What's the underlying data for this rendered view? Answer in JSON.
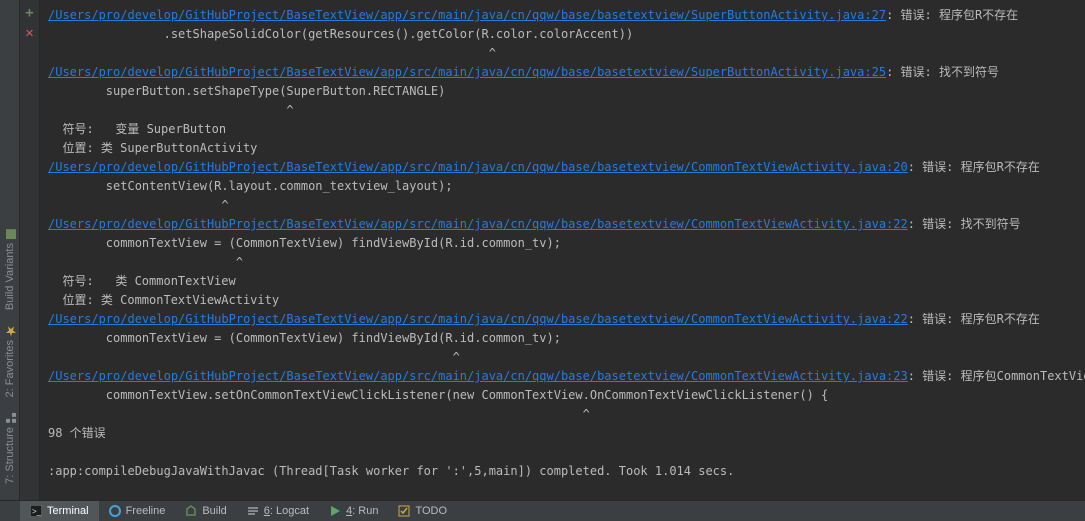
{
  "sidebar": {
    "tabs": [
      {
        "label": "Build Variants"
      },
      {
        "label": "2: Favorites"
      },
      {
        "label": "7: Structure"
      }
    ]
  },
  "gutter": {
    "plus": "+",
    "cross": "✕"
  },
  "console": {
    "entries": [
      {
        "link": "/Users/pro/develop/GitHubProject/BaseTextView/app/src/main/java/cn/qqw/base/basetextview/SuperButtonActivity.java:27",
        "label": ": 错误: 程序包R不存在",
        "code": "                .setShapeSolidColor(getResources().getColor(R.color.colorAccent))",
        "caret": "                                                             ^"
      },
      {
        "link": "/Users/pro/develop/GitHubProject/BaseTextView/app/src/main/java/cn/qqw/base/basetextview/SuperButtonActivity.java:25",
        "label": ": 错误: 找不到符号",
        "code": "        superButton.setShapeType(SuperButton.RECTANGLE)",
        "caret": "                                 ^",
        "extra": [
          "  符号:   变量 SuperButton",
          "  位置: 类 SuperButtonActivity"
        ]
      },
      {
        "link": "/Users/pro/develop/GitHubProject/BaseTextView/app/src/main/java/cn/qqw/base/basetextview/CommonTextViewActivity.java:20",
        "label": ": 错误: 程序包R不存在",
        "code": "        setContentView(R.layout.common_textview_layout);",
        "caret": "                        ^"
      },
      {
        "link": "/Users/pro/develop/GitHubProject/BaseTextView/app/src/main/java/cn/qqw/base/basetextview/CommonTextViewActivity.java:22",
        "label": ": 错误: 找不到符号",
        "code": "        commonTextView = (CommonTextView) findViewById(R.id.common_tv);",
        "caret": "                          ^",
        "extra": [
          "  符号:   类 CommonTextView",
          "  位置: 类 CommonTextViewActivity"
        ]
      },
      {
        "link": "/Users/pro/develop/GitHubProject/BaseTextView/app/src/main/java/cn/qqw/base/basetextview/CommonTextViewActivity.java:22",
        "label": ": 错误: 程序包R不存在",
        "code": "        commonTextView = (CommonTextView) findViewById(R.id.common_tv);",
        "caret": "                                                        ^"
      },
      {
        "link": "/Users/pro/develop/GitHubProject/BaseTextView/app/src/main/java/cn/qqw/base/basetextview/CommonTextViewActivity.java:23",
        "label": ": 错误: 程序包CommonTextView不",
        "code": "        commonTextView.setOnCommonTextViewClickListener(new CommonTextView.OnCommonTextViewClickListener() {",
        "caret": "                                                                          ^"
      }
    ],
    "error_count": "98 个错误",
    "footer": ":app:compileDebugJavaWithJavac (Thread[Task worker for ':',5,main]) completed. Took 1.014 secs."
  },
  "bottombar": {
    "items": [
      {
        "label": "Terminal",
        "icon": "terminal",
        "active": true
      },
      {
        "label": "Freeline",
        "icon": "freeline"
      },
      {
        "label": "Build",
        "icon": "build"
      },
      {
        "label": "6: Logcat",
        "icon": "logcat",
        "ukey": "6"
      },
      {
        "label": "4: Run",
        "icon": "run",
        "ukey": "4"
      },
      {
        "label": "TODO",
        "icon": "todo"
      }
    ]
  }
}
